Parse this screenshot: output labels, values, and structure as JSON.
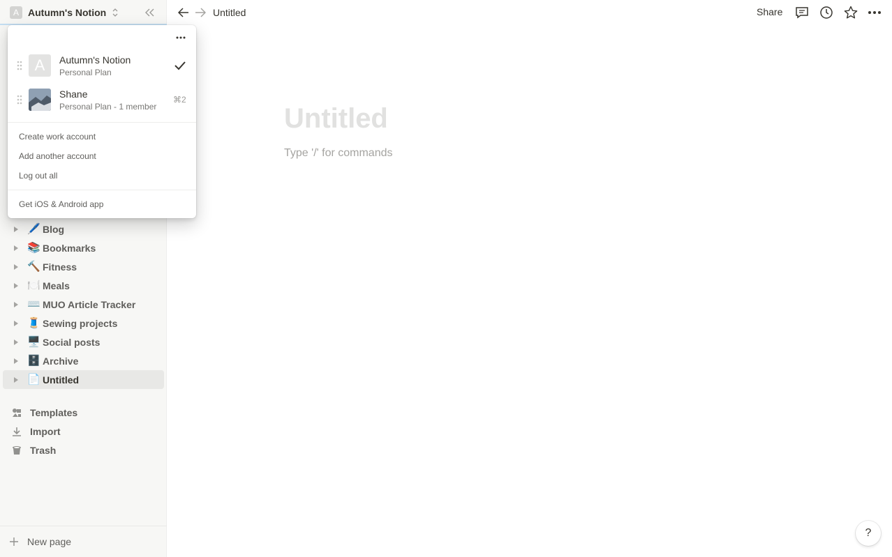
{
  "sidebar": {
    "workspace": {
      "avatar_letter": "A",
      "name": "Autumn's Notion"
    },
    "pages": [
      {
        "emoji": "🖊️",
        "label": "Blog"
      },
      {
        "emoji": "📚",
        "label": "Bookmarks"
      },
      {
        "emoji": "🔨",
        "label": "Fitness"
      },
      {
        "emoji": "🍽️",
        "label": "Meals"
      },
      {
        "emoji": "⌨️",
        "label": "MUO Article Tracker"
      },
      {
        "emoji": "🧵",
        "label": "Sewing projects"
      },
      {
        "emoji": "🖥️",
        "label": "Social posts"
      },
      {
        "emoji": "🗄️",
        "label": "Archive"
      },
      {
        "emoji": "📄",
        "label": "Untitled"
      }
    ],
    "utilities": [
      {
        "icon": "templates-icon",
        "label": "Templates"
      },
      {
        "icon": "import-icon",
        "label": "Import"
      },
      {
        "icon": "trash-icon",
        "label": "Trash"
      }
    ],
    "new_page_label": "New page"
  },
  "topbar": {
    "breadcrumb": "Untitled",
    "share_label": "Share"
  },
  "page": {
    "title_placeholder": "Untitled",
    "body_placeholder": "Type '/' for commands"
  },
  "account_menu": {
    "accounts": [
      {
        "avatar_letter": "A",
        "name": "Autumn's Notion",
        "plan": "Personal Plan",
        "selected": true
      },
      {
        "name": "Shane",
        "plan": "Personal Plan - 1 member",
        "shortcut": "⌘2"
      }
    ],
    "actions": [
      "Create work account",
      "Add another account",
      "Log out all"
    ],
    "footer": "Get iOS & Android app"
  },
  "help_label": "?",
  "colors": {
    "sidebar_bg": "#f7f7f5",
    "text": "#37352f",
    "muted": "#787774"
  }
}
